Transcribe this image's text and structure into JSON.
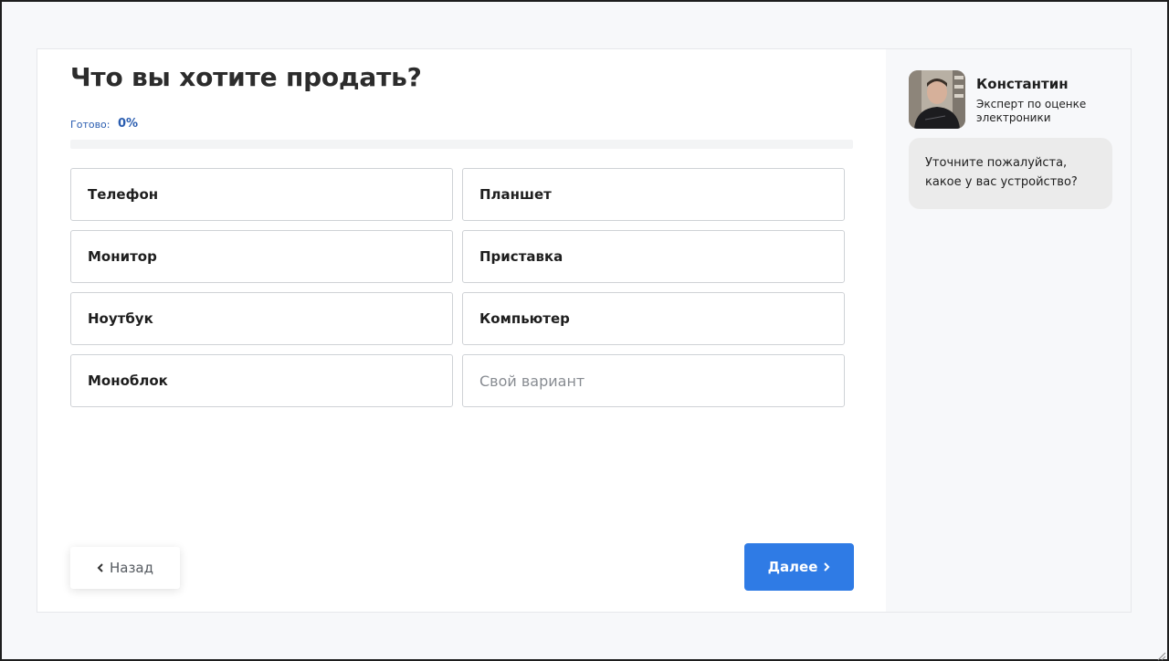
{
  "quiz": {
    "title": "Что вы хотите продать?",
    "progress_label": "Готово:",
    "progress_value": "0%",
    "progress_percent": 0,
    "options": [
      {
        "label": "Телефон"
      },
      {
        "label": "Планшет"
      },
      {
        "label": "Монитор"
      },
      {
        "label": "Приставка"
      },
      {
        "label": "Ноутбук"
      },
      {
        "label": "Компьютер"
      },
      {
        "label": "Моноблок"
      }
    ],
    "custom_placeholder": "Свой вариант",
    "back_label": "Назад",
    "next_label": "Далее"
  },
  "expert": {
    "name": "Константин",
    "role": "Эксперт по оценке электроники",
    "message": "Уточните пожалуйста, какое у вас устройство?"
  },
  "colors": {
    "accent": "#2f7be5",
    "progress_text": "#2a5db0",
    "bubble_bg": "#ebebeb"
  },
  "icons": {
    "back": "chevron-left-icon",
    "next": "chevron-right-icon"
  }
}
